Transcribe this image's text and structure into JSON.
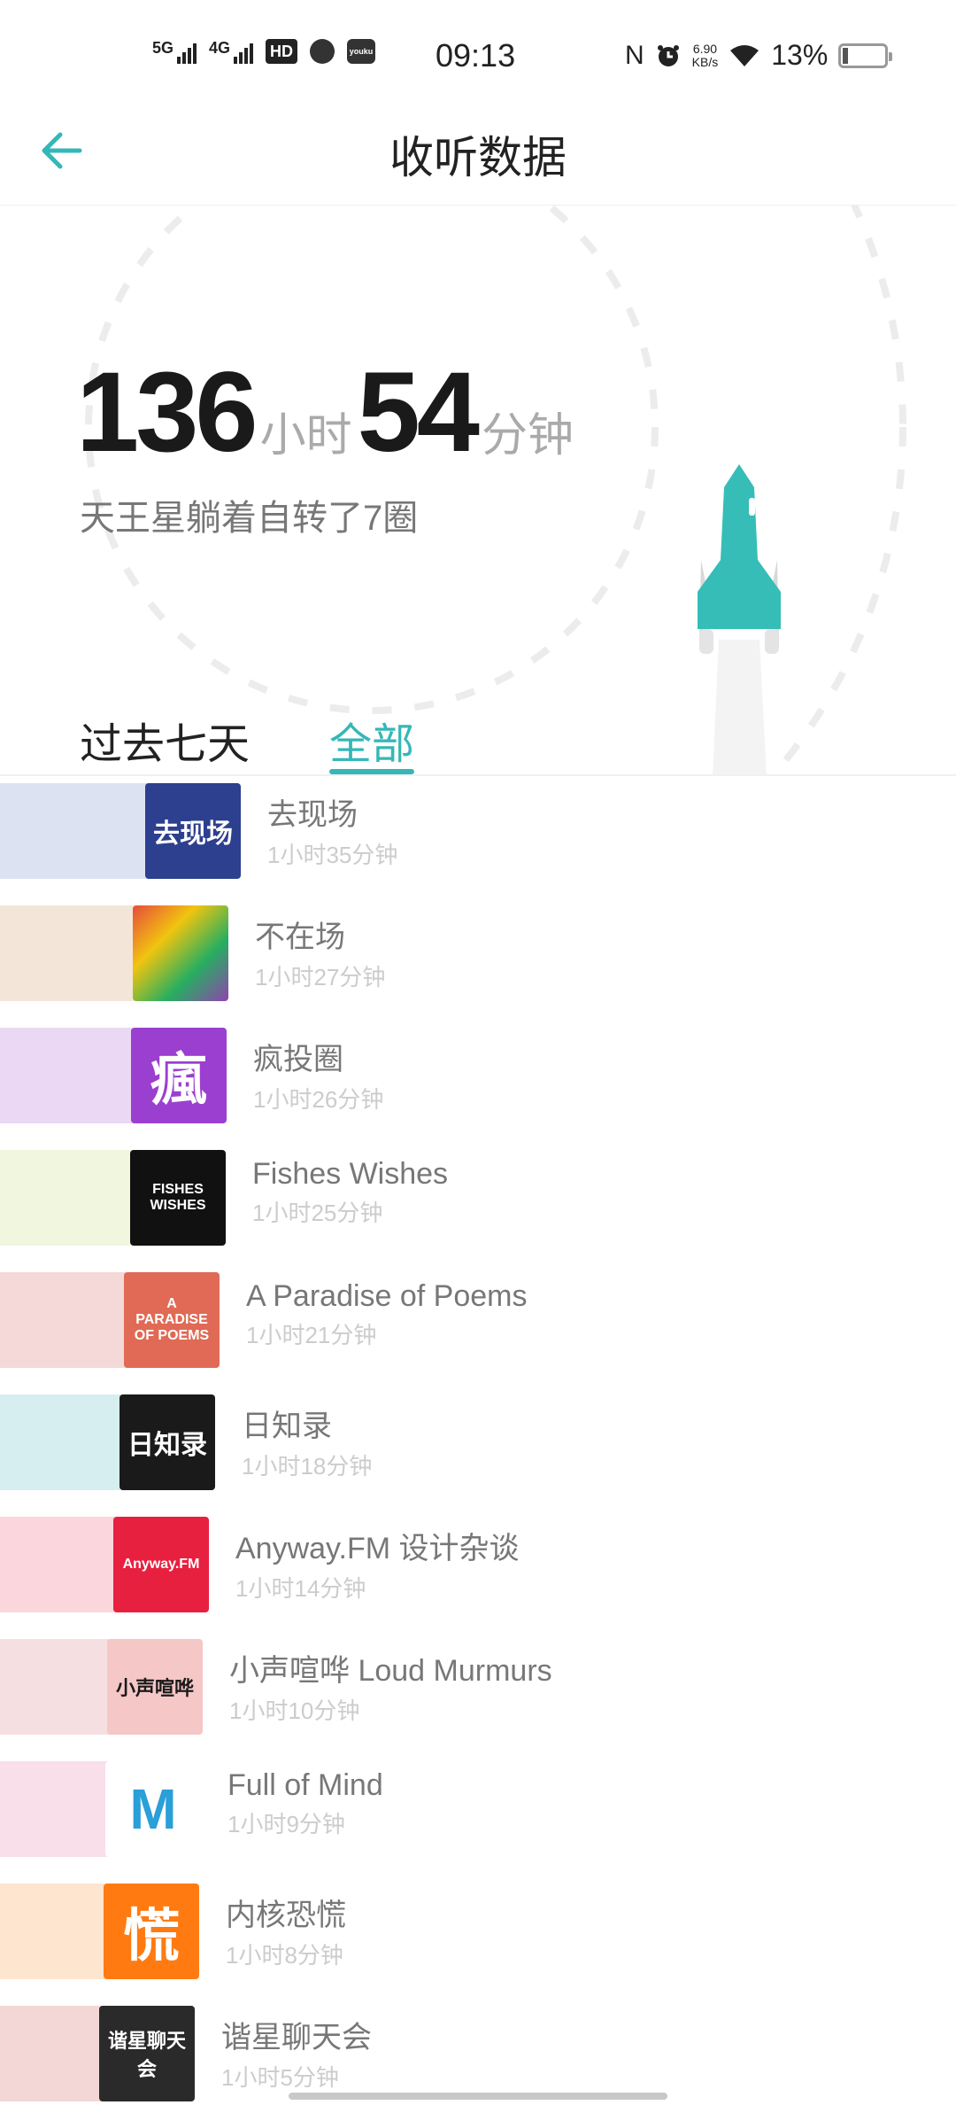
{
  "status_bar": {
    "sig1": "5G",
    "sig2": "4G",
    "hd": "HD",
    "youku": "youku",
    "time": "09:13",
    "nfc": "N",
    "speed_value": "6.90",
    "speed_unit": "KB/s",
    "battery": "13%"
  },
  "header": {
    "title": "收听数据"
  },
  "summary": {
    "hours": "136",
    "hours_unit": "小时",
    "minutes": "54",
    "minutes_unit": "分钟",
    "subtitle": "天王星躺着自转了7圈"
  },
  "tabs": [
    {
      "label": "过去七天",
      "active": false
    },
    {
      "label": "全部",
      "active": true
    }
  ],
  "colors": {
    "accent": "#35b7b7",
    "rocket": "#36bdb8"
  },
  "podcasts": [
    {
      "name": "去现场",
      "duration": "1小时35分钟",
      "minutes": 95,
      "bar_color": "#dde2f3",
      "cover": "去现场",
      "cover_bg": "#2d3f8f",
      "cover_fg": "#ffffff"
    },
    {
      "name": "不在场",
      "duration": "1小时27分钟",
      "minutes": 87,
      "bar_color": "#f3e6d8",
      "cover": "",
      "cover_bg": "linear-gradient(135deg,#e74c3c,#f1c40f,#27ae60,#8e44ad)",
      "cover_fg": "#ffffff"
    },
    {
      "name": "疯投圈",
      "duration": "1小时26分钟",
      "minutes": 86,
      "bar_color": "#ead8f4",
      "cover": "瘋",
      "cover_bg": "#9b3fd0",
      "cover_fg": "#ffffff"
    },
    {
      "name": "Fishes Wishes",
      "duration": "1小时25分钟",
      "minutes": 85,
      "bar_color": "#f1f6df",
      "cover": "FISHES WISHES",
      "cover_bg": "#111111",
      "cover_fg": "#ffffff"
    },
    {
      "name": "A Paradise of Poems",
      "duration": "1小时21分钟",
      "minutes": 81,
      "bar_color": "#f4d9d8",
      "cover": "A PARADISE OF POEMS",
      "cover_bg": "#e06a55",
      "cover_fg": "#ffffff"
    },
    {
      "name": "日知录",
      "duration": "1小时18分钟",
      "minutes": 78,
      "bar_color": "#d6eef0",
      "cover": "日知录",
      "cover_bg": "#1a1a1a",
      "cover_fg": "#ffffff"
    },
    {
      "name": "Anyway.FM 设计杂谈",
      "duration": "1小时14分钟",
      "minutes": 74,
      "bar_color": "#fbd6dd",
      "cover": "Anyway.FM",
      "cover_bg": "#e8203f",
      "cover_fg": "#ffffff"
    },
    {
      "name": "小声喧哗 Loud Murmurs",
      "duration": "1小时10分钟",
      "minutes": 70,
      "bar_color": "#f6dfe0",
      "cover": "小声喧哗",
      "cover_bg": "#f5c7c7",
      "cover_fg": "#1a1a1a"
    },
    {
      "name": "Full of Mind",
      "duration": "1小时9分钟",
      "minutes": 69,
      "bar_color": "#f8dfe9",
      "cover": "M",
      "cover_bg": "#ffffff",
      "cover_fg": "#2a9fd8"
    },
    {
      "name": "内核恐慌",
      "duration": "1小时8分钟",
      "minutes": 68,
      "bar_color": "#fde5d0",
      "cover": "慌",
      "cover_bg": "#ff7b12",
      "cover_fg": "#ffffff"
    },
    {
      "name": "谐星聊天会",
      "duration": "1小时5分钟",
      "minutes": 65,
      "bar_color": "#f3d7d7",
      "cover": "谐星聊天会",
      "cover_bg": "#2a2a2a",
      "cover_fg": "#ffffff"
    }
  ]
}
